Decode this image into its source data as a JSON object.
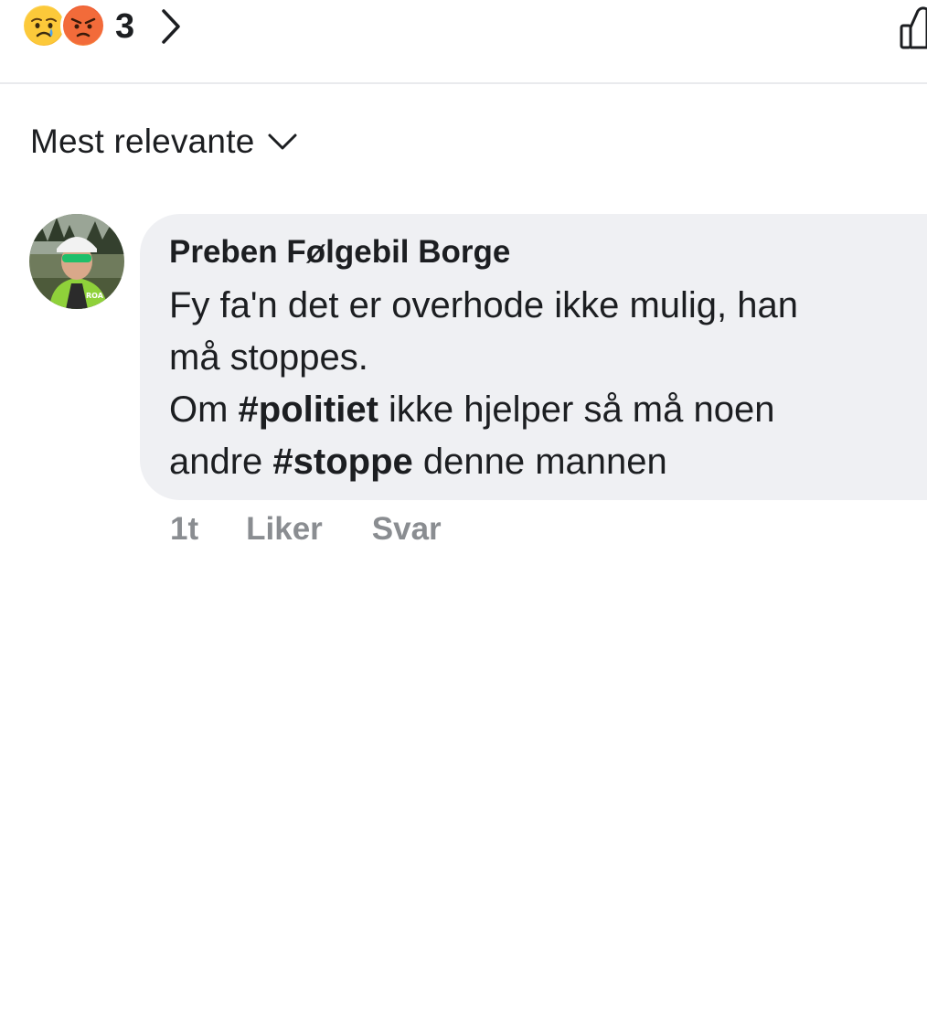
{
  "reactions": {
    "icons": [
      "sad-emoji-icon",
      "angry-emoji-icon"
    ],
    "count": "3",
    "chevron": "chevron-right-icon",
    "like_icon": "like-outline-icon"
  },
  "sort": {
    "label": "Mest relevante",
    "icon": "chevron-down-icon"
  },
  "comment": {
    "author": "Preben Følgebil Borge",
    "line1": "Fy fa'n det er overhode ikke mulig, han",
    "line2": "må stoppes.",
    "line3_prefix": "Om ",
    "hashtag1": "#politiet",
    "line3_suffix": " ikke hjelper så må noen",
    "line4_prefix": "andre ",
    "hashtag2": "#stoppe",
    "line4_suffix": " denne mannen",
    "timestamp": "1t",
    "like_label": "Liker",
    "reply_label": "Svar"
  },
  "colors": {
    "text": "#1c1e21",
    "secondary_text": "#8a8d91",
    "bubble": "#eff0f3",
    "divider": "#e9eaed"
  }
}
